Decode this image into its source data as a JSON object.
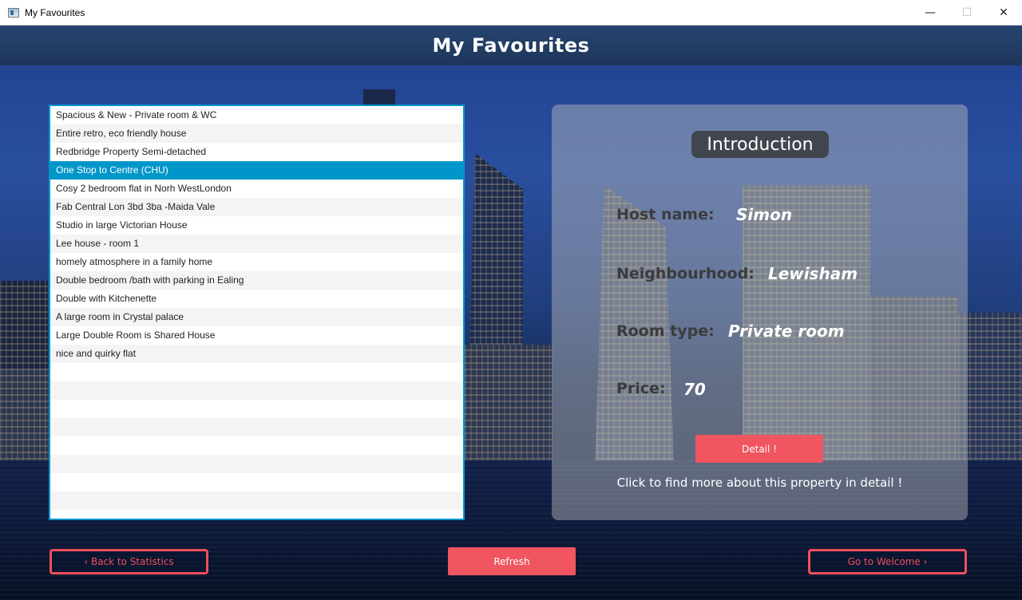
{
  "window": {
    "title": "My Favourites",
    "controls": {
      "minimize": "—",
      "maximize": "☐",
      "close": "✕"
    }
  },
  "header": {
    "title": "My Favourites"
  },
  "favourites": {
    "items": [
      "Spacious & New - Private room & WC",
      "Entire retro, eco friendly house",
      "Redbridge Property Semi-detached",
      "One Stop to Centre (CHU)",
      "Cosy 2 bedroom flat in Norh WestLondon",
      "Fab Central Lon 3bd 3ba -Maida Vale",
      "Studio in large Victorian House",
      "Lee house - room 1",
      "homely atmosphere in a family home",
      "Double bedroom /bath with parking in Ealing",
      "Double with Kitchenette",
      "A large room in Crystal palace",
      "Large Double Room is Shared House",
      "nice and quirky flat"
    ],
    "selected_index": 3
  },
  "introduction": {
    "title": "Introduction",
    "host_label": "Host name:",
    "host_value": "Simon",
    "neighbourhood_label": "Neighbourhood:",
    "neighbourhood_value": "Lewisham",
    "room_type_label": "Room type:",
    "room_type_value": "Private room",
    "price_label": "Price:",
    "price_value": "70",
    "detail_button": "Detail !",
    "detail_hint": "Click to find more about this property in detail !"
  },
  "footer": {
    "back_button": "‹ Back to Statistics",
    "refresh_button": "Refresh",
    "welcome_button": "Go to Welcome ›"
  },
  "colors": {
    "accent": "#f05560",
    "selection": "#0096c9",
    "header": "#1e355a"
  }
}
